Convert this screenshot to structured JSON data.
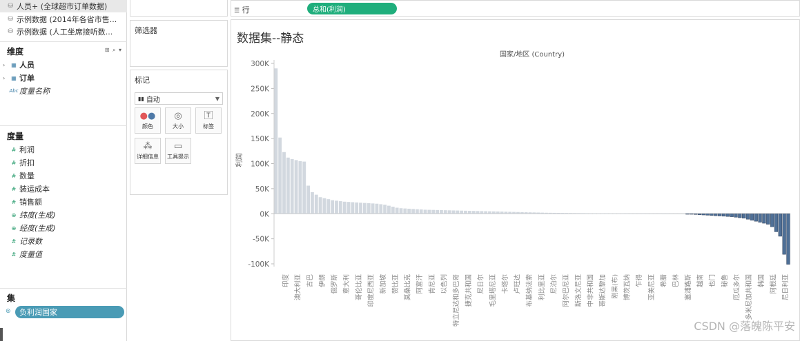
{
  "datasources": [
    {
      "label": "人员+ (全球超市订单数据)",
      "active": true
    },
    {
      "label": "示例数据 (2014年各省市售...",
      "active": false
    },
    {
      "label": "示例数据 (人工坐席接听数...",
      "active": false
    }
  ],
  "dimensions": {
    "title": "维度",
    "tools": "⊞ ⌕ ▾",
    "items": [
      {
        "label": "人员",
        "icon": "table-icon",
        "bold": true,
        "caret": "›"
      },
      {
        "label": "订单",
        "icon": "table-icon",
        "bold": true,
        "caret": "›"
      },
      {
        "label": "度量名称",
        "icon": "abc-icon",
        "italic": true,
        "type": "Abc"
      }
    ]
  },
  "measures": {
    "title": "度量",
    "items": [
      {
        "label": "利润",
        "type": "#",
        "italic": false
      },
      {
        "label": "折扣",
        "type": "#",
        "italic": false
      },
      {
        "label": "数量",
        "type": "#",
        "italic": false
      },
      {
        "label": "装运成本",
        "type": "#",
        "italic": false
      },
      {
        "label": "销售额",
        "type": "#",
        "italic": false
      },
      {
        "label": "纬度(生成)",
        "type": "⊕",
        "italic": true
      },
      {
        "label": "经度(生成)",
        "type": "⊕",
        "italic": true
      },
      {
        "label": "记录数",
        "type": "#",
        "italic": true
      },
      {
        "label": "度量值",
        "type": "#",
        "italic": true
      }
    ]
  },
  "sets": {
    "title": "集",
    "pill": "负利润国家"
  },
  "filters": {
    "title": "筛选器"
  },
  "marks": {
    "title": "标记",
    "type_label": "自动",
    "buttons": [
      {
        "label": "颜色",
        "icon": "color-dots-icon"
      },
      {
        "label": "大小",
        "icon": "size-icon"
      },
      {
        "label": "标签",
        "icon": "label-icon"
      },
      {
        "label": "详细信息",
        "icon": "detail-icon"
      },
      {
        "label": "工具提示",
        "icon": "tooltip-icon"
      }
    ]
  },
  "rows_shelf": {
    "label": "行",
    "pill": "总和(利润)"
  },
  "sheet_title": "数据集--静态",
  "watermark": "CSDN @落魄陈平安",
  "colors": {
    "positive": "#d2d8df",
    "negative": "#4e6f96",
    "pill_green": "#1fae7c",
    "pill_set": "#4a9bb5"
  },
  "chart_data": {
    "type": "bar",
    "title": "国家/地区 (Country)",
    "ylabel": "利润",
    "ylim": [
      -100000,
      300000
    ],
    "y_ticks": [
      "300K",
      "250K",
      "200K",
      "150K",
      "100K",
      "50K",
      "0K",
      "-50K",
      "-100K"
    ],
    "y_tick_values": [
      300000,
      250000,
      200000,
      150000,
      100000,
      50000,
      0,
      -50000,
      -100000
    ],
    "visible_categories": [
      "印度",
      "澳大利亚",
      "古巴",
      "伊朗",
      "俄罗斯",
      "意大利",
      "哥伦比亚",
      "印度尼西亚",
      "新加坡",
      "赞比亚",
      "莫桑比克",
      "阿富汗",
      "肯尼亚",
      "以色列",
      "特立尼达和多巴哥",
      "捷克共和国",
      "尼日尔",
      "毛里塔尼亚",
      "卡塔尔",
      "卢旺达",
      "布基纳法索",
      "利比里亚",
      "尼泊尔",
      "阿尔巴尼亚",
      "斯洛文尼亚",
      "中非共和国",
      "哥斯达黎加",
      "刚果(布)",
      "博茨瓦纳",
      "乍得",
      "亚美尼亚",
      "希腊",
      "巴林",
      "塞浦路斯",
      "越南",
      "也门",
      "秘鲁",
      "厄瓜多尔",
      "多米尼加共和国",
      "韩国",
      "阿根廷",
      "尼日利亚"
    ],
    "values": [
      290000,
      152000,
      123000,
      112000,
      109000,
      107000,
      105000,
      104000,
      56000,
      43000,
      38000,
      33000,
      31000,
      29000,
      27000,
      26000,
      25000,
      24000,
      23500,
      23000,
      22500,
      22000,
      21500,
      21000,
      20500,
      20000,
      19000,
      18000,
      16000,
      14000,
      12000,
      11000,
      10500,
      10000,
      9500,
      9000,
      8500,
      8000,
      7800,
      7600,
      7400,
      7200,
      7000,
      6800,
      6600,
      6400,
      6200,
      6000,
      5800,
      5600,
      5400,
      5200,
      5000,
      4800,
      4600,
      4400,
      4200,
      4000,
      3800,
      3600,
      3400,
      3200,
      3000,
      2800,
      2600,
      2400,
      2200,
      2000,
      1900,
      1800,
      1700,
      1600,
      1500,
      1400,
      1300,
      1200,
      1100,
      1000,
      900,
      800,
      700,
      600,
      500,
      450,
      400,
      350,
      300,
      250,
      200,
      180,
      160,
      140,
      120,
      100,
      80,
      60,
      50,
      40,
      30,
      20,
      10,
      5,
      -500,
      -1000,
      -1500,
      -2000,
      -2500,
      -3000,
      -3500,
      -4000,
      -4500,
      -5000,
      -5500,
      -6000,
      -7000,
      -8000,
      -9000,
      -11000,
      -13000,
      -15000,
      -17000,
      -19000,
      -21000,
      -26000,
      -36000,
      -45000,
      -81000,
      -101000
    ]
  }
}
